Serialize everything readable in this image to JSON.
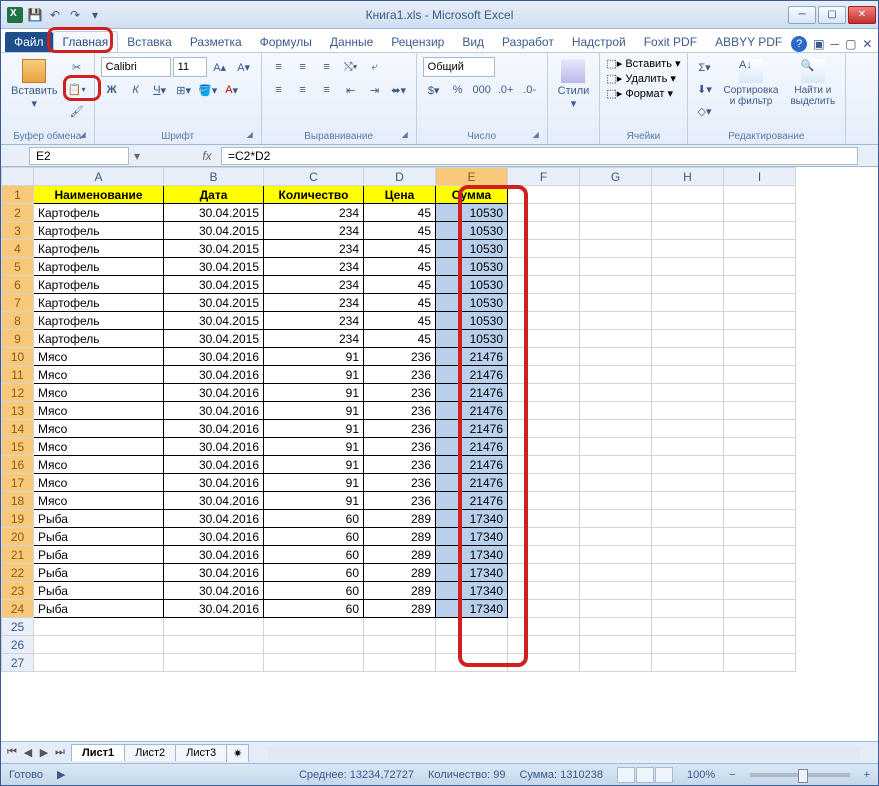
{
  "title": "Книга1.xls - Microsoft Excel",
  "qat": {
    "save": "💾",
    "undo": "↶",
    "redo": "↷"
  },
  "tabs": {
    "file": "Файл",
    "home": "Главная",
    "insert": "Вставка",
    "layout": "Разметка",
    "formulas": "Формулы",
    "data": "Данные",
    "review": "Рецензир",
    "view": "Вид",
    "developer": "Разработ",
    "addins": "Надстрой",
    "foxit": "Foxit PDF",
    "abbyy": "ABBYY PDF"
  },
  "ribbon": {
    "clipboard": {
      "paste": "Вставить",
      "label": "Буфер обмена"
    },
    "font": {
      "name": "Calibri",
      "size": "11",
      "label": "Шрифт"
    },
    "align": {
      "label": "Выравнивание"
    },
    "number": {
      "format": "Общий",
      "label": "Число"
    },
    "styles": {
      "label": "Стили"
    },
    "cells": {
      "insert": "Вставить",
      "delete": "Удалить",
      "format": "Формат",
      "label": "Ячейки"
    },
    "editing": {
      "sort": "Сортировка\nи фильтр",
      "find": "Найти и\nвыделить",
      "label": "Редактирование"
    }
  },
  "namebox": "E2",
  "formula": "=C2*D2",
  "headers": [
    "Наименование",
    "Дата",
    "Количество",
    "Цена",
    "Сумма"
  ],
  "columns": [
    "A",
    "B",
    "C",
    "D",
    "E",
    "F",
    "G",
    "H",
    "I"
  ],
  "rows": [
    {
      "n": "Картофель",
      "d": "30.04.2015",
      "q": 234,
      "p": 45,
      "s": 10530
    },
    {
      "n": "Картофель",
      "d": "30.04.2015",
      "q": 234,
      "p": 45,
      "s": 10530
    },
    {
      "n": "Картофель",
      "d": "30.04.2015",
      "q": 234,
      "p": 45,
      "s": 10530
    },
    {
      "n": "Картофель",
      "d": "30.04.2015",
      "q": 234,
      "p": 45,
      "s": 10530
    },
    {
      "n": "Картофель",
      "d": "30.04.2015",
      "q": 234,
      "p": 45,
      "s": 10530
    },
    {
      "n": "Картофель",
      "d": "30.04.2015",
      "q": 234,
      "p": 45,
      "s": 10530
    },
    {
      "n": "Картофель",
      "d": "30.04.2015",
      "q": 234,
      "p": 45,
      "s": 10530
    },
    {
      "n": "Картофель",
      "d": "30.04.2015",
      "q": 234,
      "p": 45,
      "s": 10530
    },
    {
      "n": "Мясо",
      "d": "30.04.2016",
      "q": 91,
      "p": 236,
      "s": 21476
    },
    {
      "n": "Мясо",
      "d": "30.04.2016",
      "q": 91,
      "p": 236,
      "s": 21476
    },
    {
      "n": "Мясо",
      "d": "30.04.2016",
      "q": 91,
      "p": 236,
      "s": 21476
    },
    {
      "n": "Мясо",
      "d": "30.04.2016",
      "q": 91,
      "p": 236,
      "s": 21476
    },
    {
      "n": "Мясо",
      "d": "30.04.2016",
      "q": 91,
      "p": 236,
      "s": 21476
    },
    {
      "n": "Мясо",
      "d": "30.04.2016",
      "q": 91,
      "p": 236,
      "s": 21476
    },
    {
      "n": "Мясо",
      "d": "30.04.2016",
      "q": 91,
      "p": 236,
      "s": 21476
    },
    {
      "n": "Мясо",
      "d": "30.04.2016",
      "q": 91,
      "p": 236,
      "s": 21476
    },
    {
      "n": "Мясо",
      "d": "30.04.2016",
      "q": 91,
      "p": 236,
      "s": 21476
    },
    {
      "n": "Рыба",
      "d": "30.04.2016",
      "q": 60,
      "p": 289,
      "s": 17340
    },
    {
      "n": "Рыба",
      "d": "30.04.2016",
      "q": 60,
      "p": 289,
      "s": 17340
    },
    {
      "n": "Рыба",
      "d": "30.04.2016",
      "q": 60,
      "p": 289,
      "s": 17340
    },
    {
      "n": "Рыба",
      "d": "30.04.2016",
      "q": 60,
      "p": 289,
      "s": 17340
    },
    {
      "n": "Рыба",
      "d": "30.04.2016",
      "q": 60,
      "p": 289,
      "s": 17340
    },
    {
      "n": "Рыба",
      "d": "30.04.2016",
      "q": 60,
      "p": 289,
      "s": 17340
    }
  ],
  "sheets": [
    "Лист1",
    "Лист2",
    "Лист3"
  ],
  "status": {
    "ready": "Готово",
    "avg_label": "Среднее:",
    "avg": "13234,72727",
    "count_label": "Количество:",
    "count": "99",
    "sum_label": "Сумма:",
    "sum": "1310238",
    "zoom": "100%"
  }
}
